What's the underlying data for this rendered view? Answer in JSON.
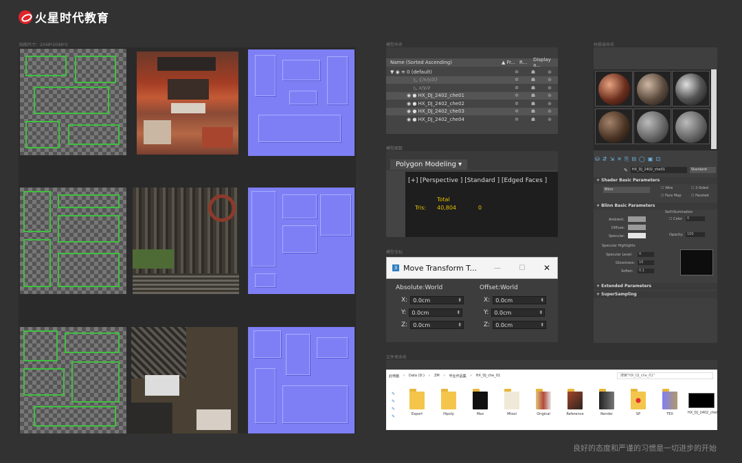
{
  "logo": {
    "text": "火星时代教育"
  },
  "labels": {
    "tex_size": "贴图尺寸：2048*2048*3",
    "model_name": "模型命名",
    "model_faces": "模型面数",
    "model_coords": "模型坐标",
    "file_naming": "文件夹命名",
    "material_naming": "材质球命名"
  },
  "footer": "良好的态度和严谨的习惯是一切进步的开始",
  "scene": {
    "headers": [
      "Name (Sorted Ascending)",
      "▲ Fr...",
      "R...",
      "Display a..."
    ],
    "rows": [
      {
        "name": "0 (default)"
      },
      {
        "name": "{/x/y/z}"
      },
      {
        "name": "x/y/z"
      },
      {
        "name": "HX_DJ_2402_che01"
      },
      {
        "name": "HX_DJ_2402_che02"
      },
      {
        "name": "HX_DJ_2402_che03"
      },
      {
        "name": "HX_DJ_2402_che04"
      }
    ]
  },
  "modeling": {
    "ribbon": "Polygon Modeling",
    "viewport_label": "[+] [Perspective ] [Standard ] [Edged Faces ]",
    "total": "Total",
    "tris_label": "Tris:",
    "tris_value": "40,804",
    "tris_sel": "0"
  },
  "transform": {
    "title": "Move Transform T...",
    "absolute": "Absolute:World",
    "offset": "Offset:World",
    "x": "X:",
    "y": "Y:",
    "z": "Z:",
    "val": "0.0cm"
  },
  "explorer": {
    "path": [
      "此电脑",
      "Data (D:)",
      "ZM",
      "毕业作品集",
      "HX_DJ_che_01"
    ],
    "search": "搜索\"HX_DJ_che_01\"",
    "folders": [
      "Export",
      "Hipoly",
      "Max",
      "Mtool",
      "Original",
      "Reference",
      "Render",
      "SP",
      "TEX",
      "HX_DJ_2402_che01"
    ]
  },
  "material": {
    "name": "HX_DJ_2402_che01",
    "type": "Standard",
    "shader_basic": "Shader Basic Parameters",
    "shader": "Blinn",
    "wire": "Wire",
    "two_sided": "2-Sided",
    "face_map": "Face Map",
    "faceted": "Faceted",
    "blinn_basic": "Blinn Basic Parameters",
    "self_illum": "Self-Illumination",
    "color": "Color",
    "color_val": "0",
    "ambient": "Ambient:",
    "diffuse": "Diffuse:",
    "specular": "Specular:",
    "opacity": "Opacity:",
    "opacity_val": "100",
    "spec_highlights": "Specular Highlights",
    "spec_level": "Specular Level:",
    "spec_level_val": "0",
    "glossiness": "Glossiness:",
    "glossiness_val": "10",
    "soften": "Soften:",
    "soften_val": "0.1",
    "extended": "Extended Parameters",
    "supersampling": "SuperSampling"
  }
}
